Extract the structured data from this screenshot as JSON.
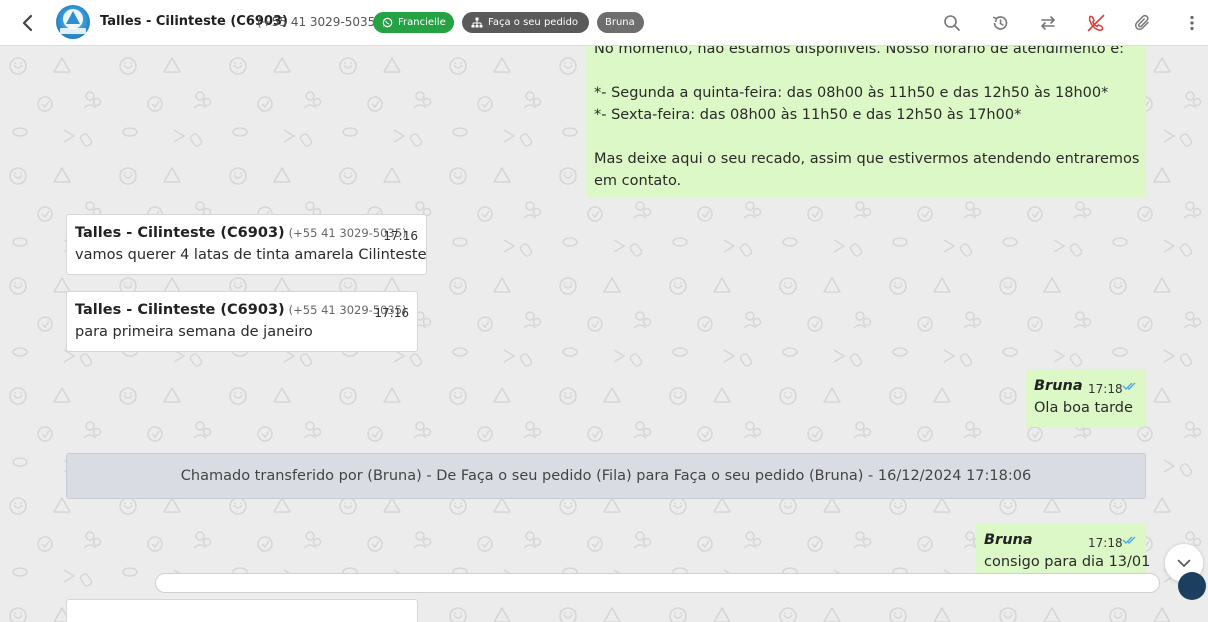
{
  "header": {
    "title": "Talles - Cilinteste (C6903)",
    "phone": "(+55 41 3029-5035)",
    "tags": [
      {
        "label": "Francielle",
        "color": "#25a244",
        "icon": "whatsapp-icon"
      },
      {
        "label": "Faça o seu pedido",
        "color": "#5a5a5a",
        "icon": "sitemap-icon"
      },
      {
        "label": "Bruna",
        "color": "#6e6e6e"
      }
    ],
    "actions": [
      "search-icon",
      "history-icon",
      "transfer-icon",
      "end-call-icon",
      "attach-icon",
      "more-vert-icon"
    ]
  },
  "messages": {
    "auto_reply": {
      "line1": "No momento, não estamos disponíveis. Nosso horário de atendimento é:",
      "line2": "*- Segunda a quinta-feira: das 08h00 às 11h50 e das 12h50 às 18h00*",
      "line3": "*- Sexta-feira: das 08h00 às 11h50 e das 12h50 às 17h00*",
      "line4": "Mas deixe aqui o seu recado, assim que estivermos atendendo entraremos",
      "line5": "em contato."
    },
    "in1": {
      "sender": "Talles - Cilinteste (C6903)",
      "phone": "(+55 41 3029-5035)",
      "time": "17:16",
      "text": "vamos querer 4 latas de tinta amarela Cilinteste"
    },
    "in2": {
      "sender": "Talles - Cilinteste (C6903)",
      "phone": "(+55 41 3029-5035)",
      "time": "17:16",
      "text": "para primeira semana de janeiro"
    },
    "out1": {
      "agent": "Bruna",
      "time": "17:18",
      "text": "Ola boa tarde",
      "status": "read"
    },
    "system": "Chamado transferido por (Bruna) - De Faça o seu pedido (Fila) para Faça o seu pedido (Bruna) - 16/12/2024 17:18:06",
    "out2": {
      "agent": "Bruna",
      "time": "17:18",
      "text": "consigo para dia 13/01",
      "status": "read"
    }
  },
  "colors": {
    "outgoing_bubble": "#dcf8c6",
    "incoming_bubble": "#ffffff",
    "system_bubble": "#d9dce3",
    "read_check": "#4fa8e6",
    "end_call_icon": "#e53935"
  }
}
